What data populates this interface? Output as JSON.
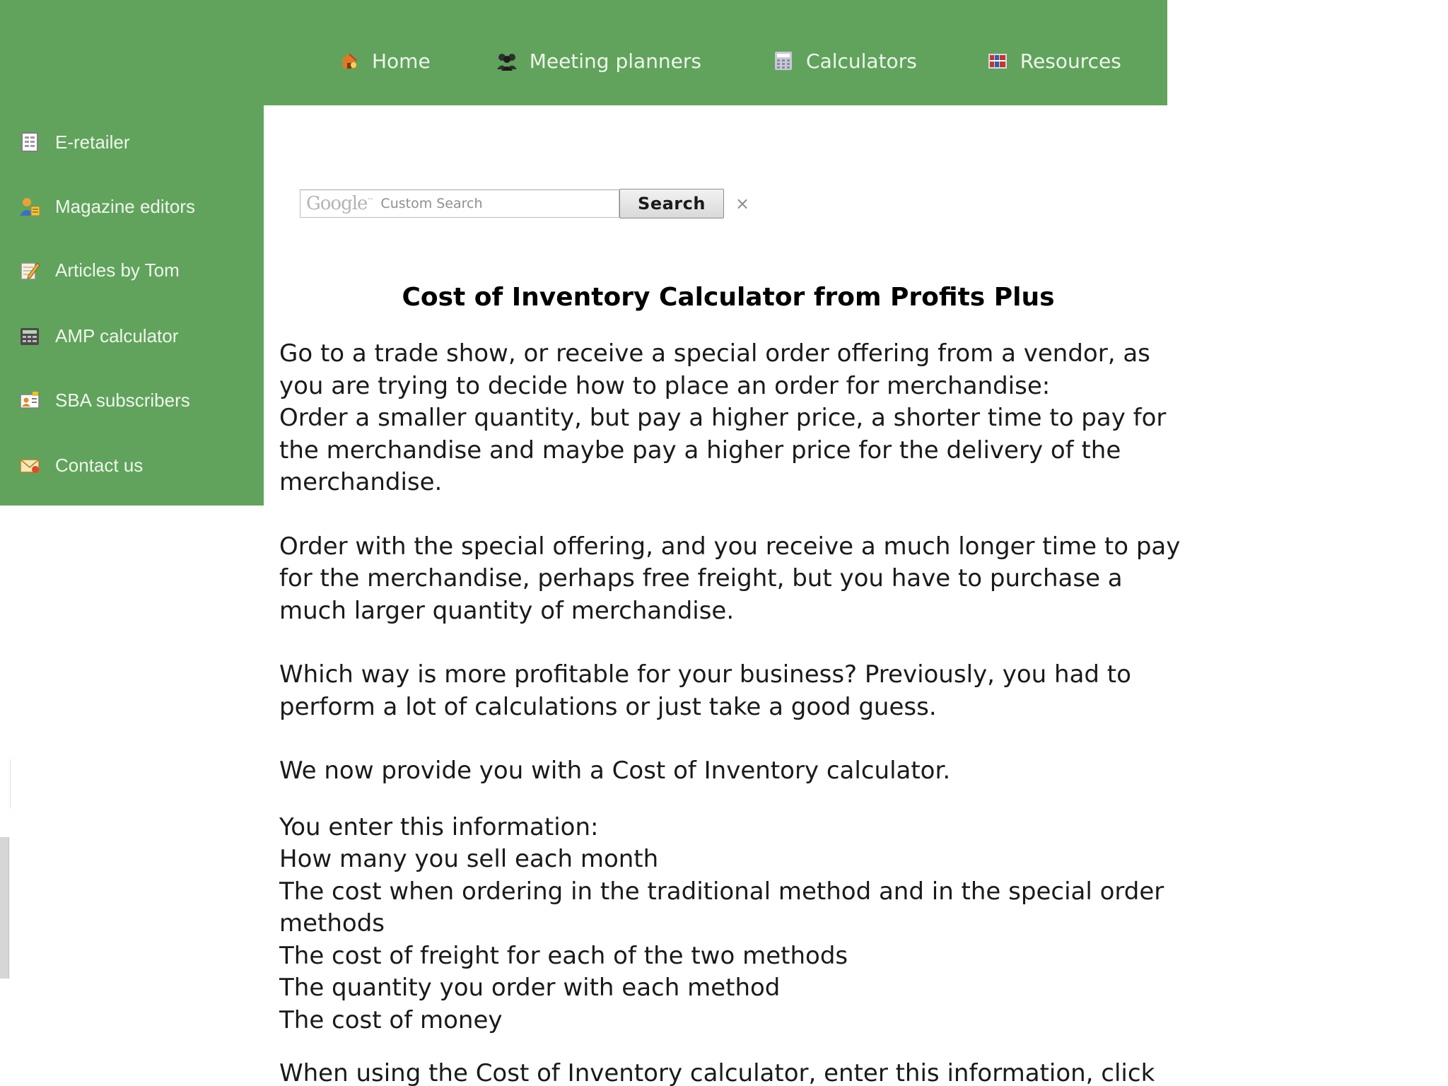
{
  "top_nav": {
    "items": [
      {
        "label": "Home",
        "icon": "home-icon"
      },
      {
        "label": "Meeting planners",
        "icon": "people-group-icon"
      },
      {
        "label": "Calculators",
        "icon": "calculator-icon"
      },
      {
        "label": "Resources",
        "icon": "books-icon"
      }
    ]
  },
  "sidebar": {
    "items": [
      {
        "label": "E-retailer",
        "icon": "document-list-icon"
      },
      {
        "label": "Magazine editors",
        "icon": "user-editors-icon"
      },
      {
        "label": "Articles by Tom",
        "icon": "notepad-pencil-icon"
      },
      {
        "label": "AMP calculator",
        "icon": "calculator-icon"
      },
      {
        "label": "SBA subscribers",
        "icon": "subscriber-card-icon"
      },
      {
        "label": "Contact us",
        "icon": "envelope-icon"
      }
    ]
  },
  "search": {
    "brand": "Google",
    "brand_mark": "™",
    "placeholder": "Custom Search",
    "button_label": "Search",
    "clear_symbol": "×"
  },
  "article": {
    "title": "Cost of Inventory Calculator from Profits Plus",
    "paragraphs": [
      "Go to a trade show, or receive a special order offering from a vendor, as you are trying to decide how to place an order for merchandise:\nOrder a smaller quantity, but pay a higher price, a shorter time to pay for the merchandise and maybe pay a higher price for the delivery of the merchandise.",
      "Order with the special offering, and you receive a much longer time to pay for the merchandise, perhaps free freight, but you have to purchase a much larger quantity of merchandise.",
      "Which way is more profitable for your business? Previously, you had to perform a lot of calculations or just take a good guess.",
      "We now provide you with a Cost of Inventory calculator.",
      "You enter this information:\nHow many you sell each month\nThe cost when ordering in the traditional method and in the special order methods\nThe cost of freight for each of the two methods\nThe quantity you order with each method\nThe cost of money",
      "When using the Cost of Inventory calculator, enter this information, click"
    ]
  },
  "colors": {
    "nav_green": "#61a35c",
    "nav_text": "#eef6ec",
    "body_text": "#1a1a1a"
  }
}
